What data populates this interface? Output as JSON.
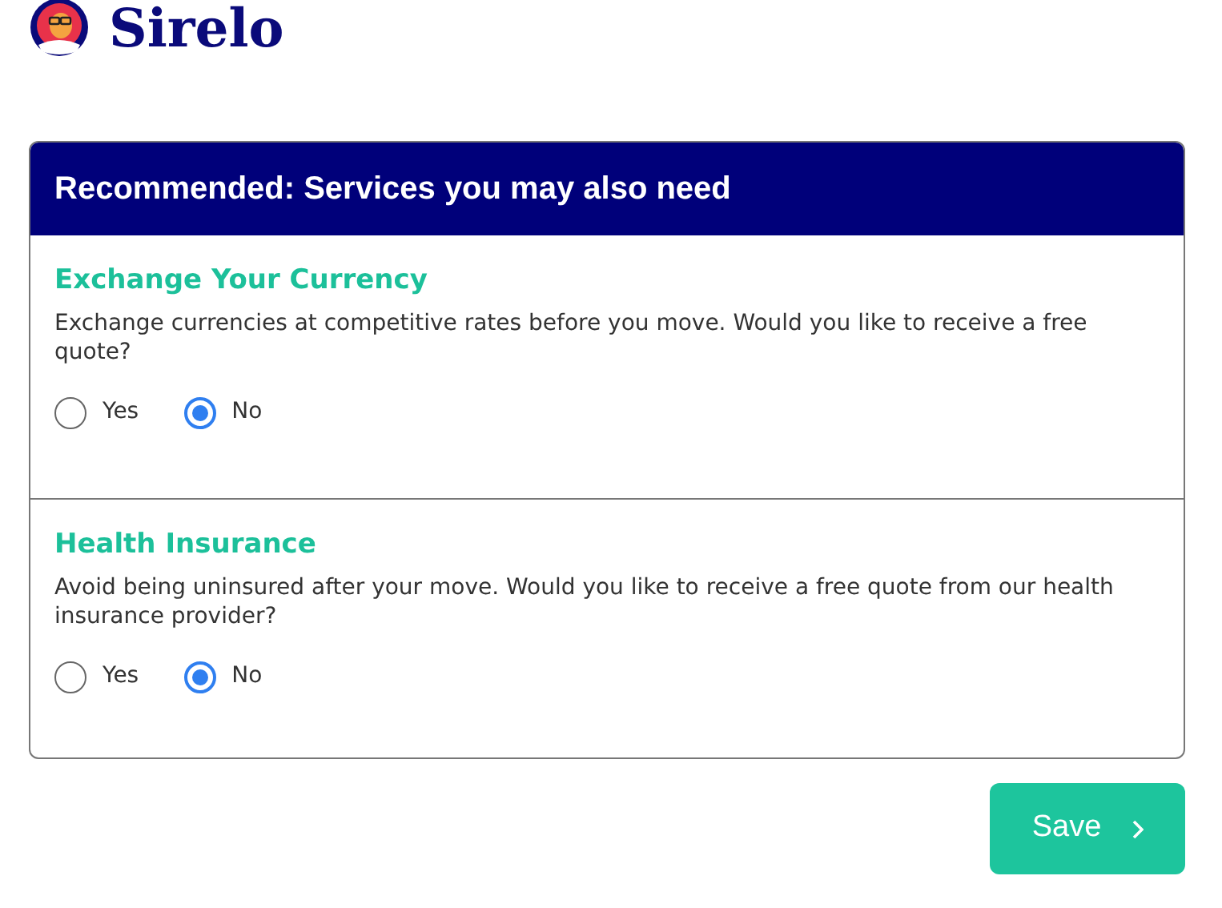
{
  "brand": {
    "name": "Sirelo"
  },
  "panel": {
    "title": "Recommended: Services you may also need",
    "sections": [
      {
        "title": "Exchange Your Currency",
        "text": "Exchange currencies at competitive rates before you move. Would you like to receive a free quote?",
        "options": [
          {
            "label": "Yes",
            "selected": false
          },
          {
            "label": "No",
            "selected": true
          }
        ]
      },
      {
        "title": "Health Insurance",
        "text": "Avoid being uninsured after your move. Would you like to receive a free quote from our health insurance provider?",
        "options": [
          {
            "label": "Yes",
            "selected": false
          },
          {
            "label": "No",
            "selected": true
          }
        ]
      }
    ]
  },
  "save_button": {
    "label": "Save"
  }
}
